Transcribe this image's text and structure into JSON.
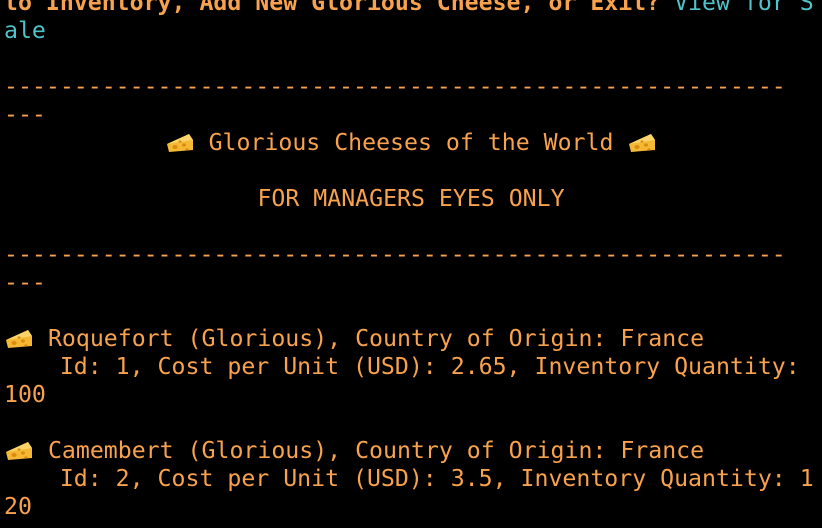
{
  "prompt": {
    "line1_bold": "to Inventory, Add New Glorious Cheese, or Exit? ",
    "line1_input": "View for S",
    "line2_input": "ale"
  },
  "header": {
    "divider_line1": "--------------------------------------------------------",
    "divider_line2": "---",
    "title": " Glorious Cheeses of the World ",
    "subtitle": "FOR MANAGERS EYES ONLY",
    "divider2_line1": "--------------------------------------------------------",
    "divider2_line2": "---"
  },
  "icons": {
    "cheese": "cheese-icon"
  },
  "cheeses": [
    {
      "name_line": " Roquefort (Glorious), Country of Origin: France",
      "detail_line": "    Id: 1, Cost per Unit (USD): 2.65, Inventory Quantity:",
      "detail_wrap": "100"
    },
    {
      "name_line": " Camembert (Glorious), Country of Origin: France",
      "detail_line": "    Id: 2, Cost per Unit (USD): 3.5, Inventory Quantity: 1",
      "detail_wrap": "20"
    }
  ],
  "colors": {
    "background": "#000000",
    "text": "#F8A24E",
    "input": "#4FC3C9",
    "cheese_fill": "#F5B835",
    "cheese_hole": "#D98B12"
  }
}
